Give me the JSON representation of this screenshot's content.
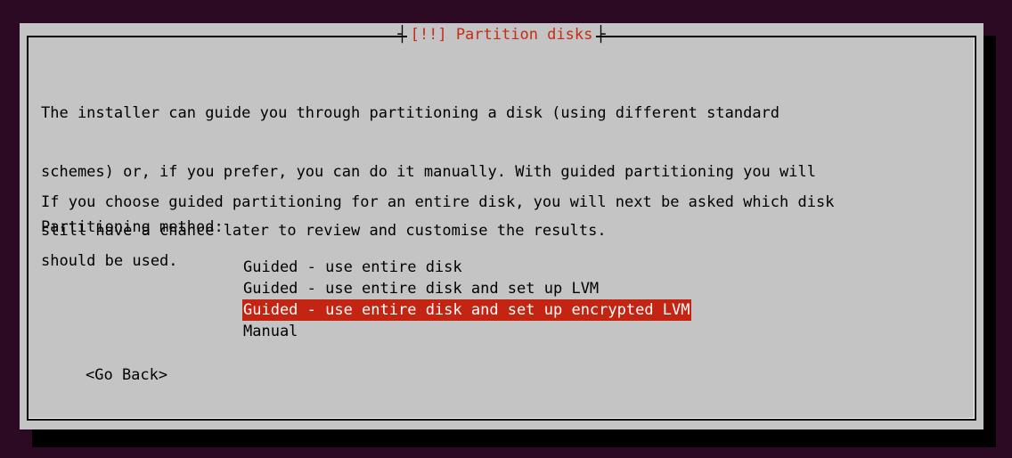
{
  "dialog": {
    "title": "[!!] Partition disks",
    "paragraph1": [
      "The installer can guide you through partitioning a disk (using different standard",
      "schemes) or, if you prefer, you can do it manually. With guided partitioning you will",
      "still have a chance later to review and customise the results."
    ],
    "paragraph2": [
      "If you choose guided partitioning for an entire disk, you will next be asked which disk",
      "should be used."
    ],
    "prompt": "Partitioning method:",
    "options": [
      {
        "label": "Guided - use entire disk",
        "selected": false
      },
      {
        "label": "Guided - use entire disk and set up LVM",
        "selected": false
      },
      {
        "label": "Guided - use entire disk and set up encrypted LVM",
        "selected": true
      },
      {
        "label": "Manual",
        "selected": false
      }
    ],
    "go_back": "<Go Back>"
  },
  "colors": {
    "background": "#2c0a24",
    "dialog": "#c4c4c4",
    "title_text": "#c82a14",
    "selection": "#c42412"
  }
}
